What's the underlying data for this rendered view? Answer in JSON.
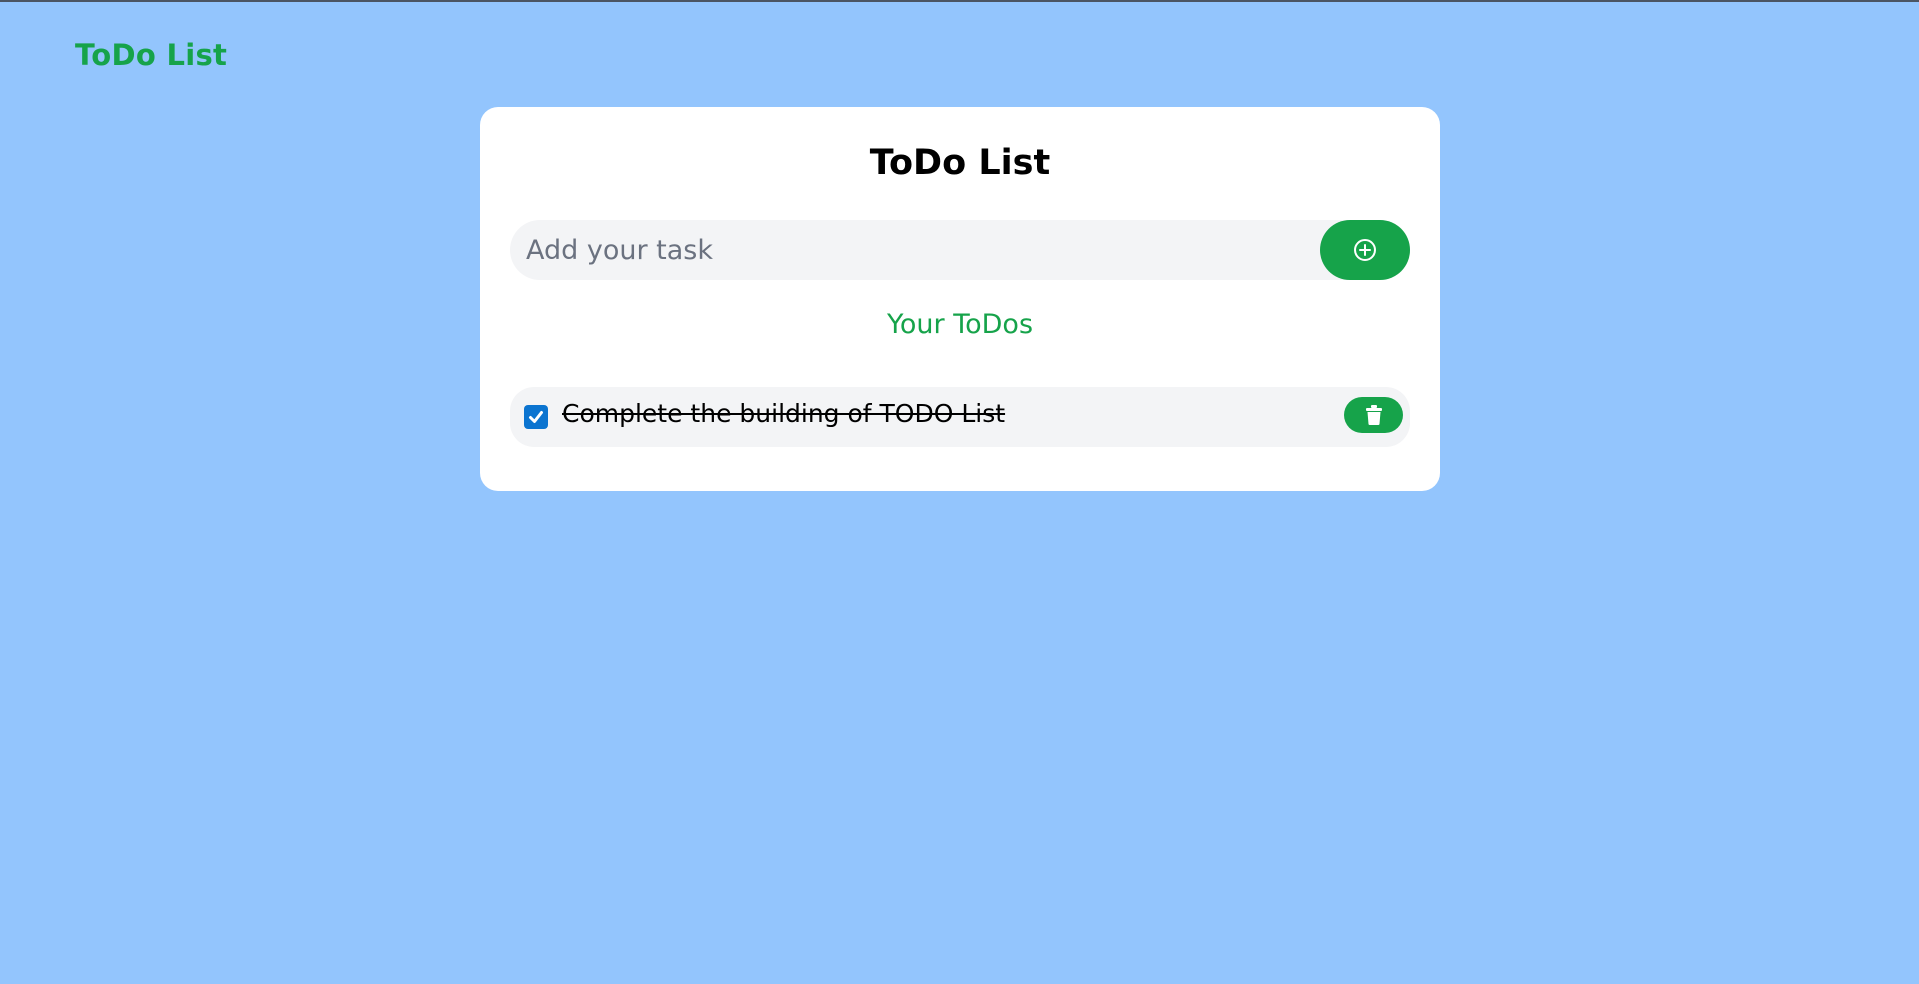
{
  "app": {
    "brand": "ToDo List"
  },
  "card": {
    "title": "ToDo List",
    "input": {
      "placeholder": "Add your task",
      "value": ""
    },
    "add_button_icon": "plus-circle-icon",
    "section_title": "Your ToDos",
    "todos": [
      {
        "text": "Complete the building of TODO List",
        "completed": true,
        "delete_icon": "trash-icon"
      }
    ]
  },
  "colors": {
    "background": "#93c5fd",
    "accent": "#16a34a",
    "card": "#ffffff",
    "field": "#f3f4f6",
    "checkbox": "#0b74d0"
  }
}
